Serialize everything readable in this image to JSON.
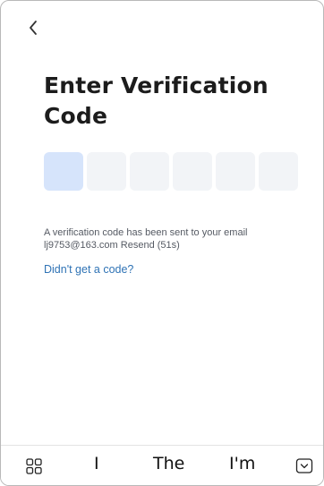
{
  "header": {
    "back_icon": "chevron-left-icon"
  },
  "page": {
    "title": "Enter Verification Code",
    "code_length": 6,
    "active_index": 0,
    "sent_message": "A verification code has been sent to your email",
    "email": "lj9753@163.com",
    "resend_label": "Resend (51s)",
    "no_code_link": "Didn't get a code?"
  },
  "keyboard": {
    "grid_icon": "grid-icon",
    "suggestions": [
      "I",
      "The",
      "I'm"
    ],
    "hide_icon": "keyboard-hide-icon"
  },
  "colors": {
    "active_box": "#d6e4fb",
    "inactive_box": "#f2f4f7",
    "link": "#2f73b5"
  }
}
